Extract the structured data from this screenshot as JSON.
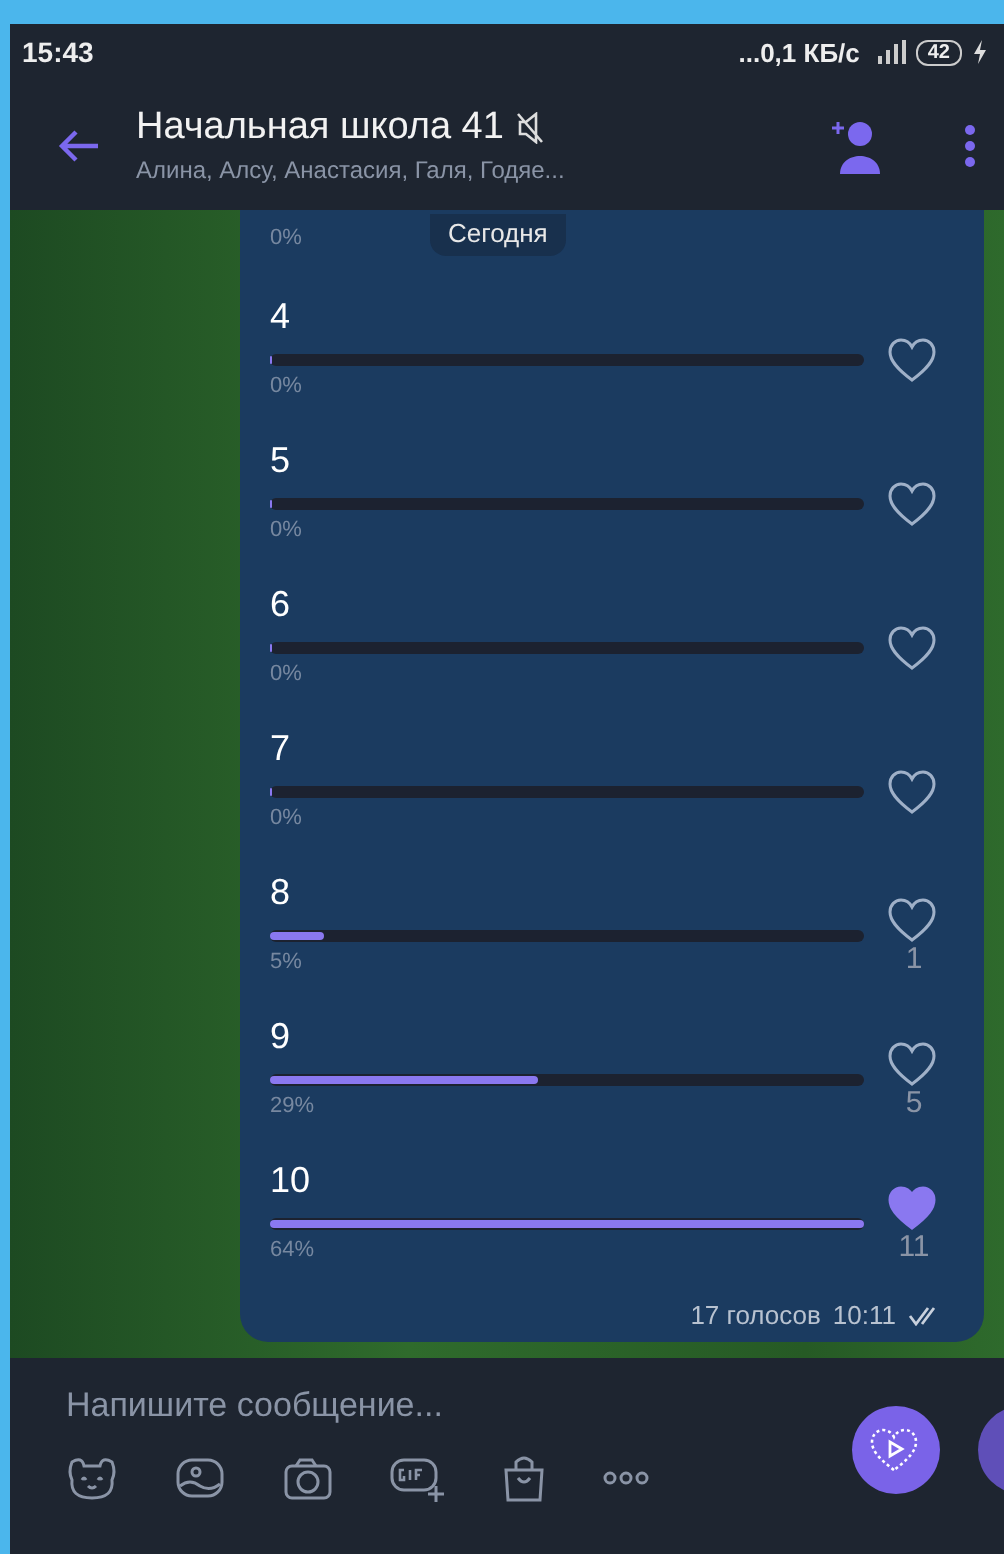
{
  "status_bar": {
    "time": "15:43",
    "network_speed": "...0,1 КБ/с",
    "battery": "42"
  },
  "header": {
    "title": "Начальная школа 41",
    "muted": true,
    "subtitle": "Алина, Алсу, Анастасия, Галя, Годяе..."
  },
  "date_chip": "Сегодня",
  "poll": {
    "options": [
      {
        "percent": "0%"
      },
      {
        "label": "4",
        "percent": "0%",
        "level": 0,
        "selected": false
      },
      {
        "label": "5",
        "percent": "0%",
        "level": 0,
        "selected": false
      },
      {
        "label": "6",
        "percent": "0%",
        "level": 0,
        "selected": false
      },
      {
        "label": "7",
        "percent": "0%",
        "level": 0,
        "selected": false
      },
      {
        "label": "8",
        "percent": "5%",
        "level": 0.09,
        "selected": false,
        "count": "1"
      },
      {
        "label": "9",
        "percent": "29%",
        "level": 0.45,
        "selected": false,
        "count": "5"
      },
      {
        "label": "10",
        "percent": "64%",
        "level": 1,
        "selected": true,
        "count": "11"
      }
    ],
    "votes": "17 голосов",
    "time": "10:11",
    "read": true
  },
  "composer": {
    "placeholder": "Напишите сообщение..."
  }
}
